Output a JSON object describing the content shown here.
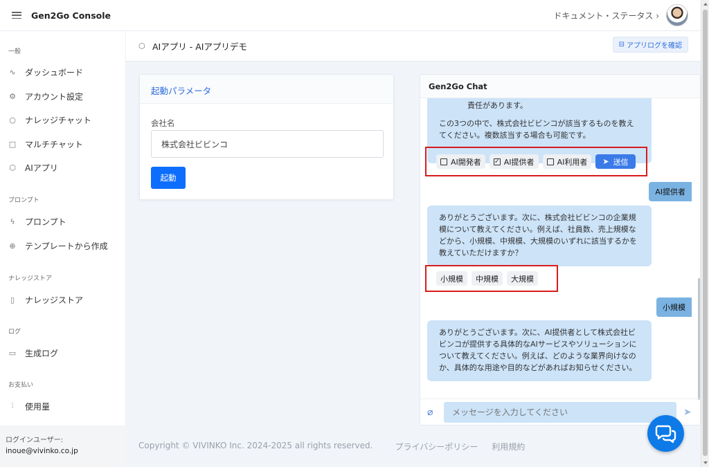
{
  "app": {
    "title": "Gen2Go Console"
  },
  "topbar": {
    "link": "ドキュメント・ステータス ›"
  },
  "sidebar": {
    "sections": [
      {
        "title": "一般",
        "items": [
          {
            "label": "ダッシュボード",
            "icon": "activity-icon"
          },
          {
            "label": "アカウント設定",
            "icon": "gear-icon"
          },
          {
            "label": "ナレッジチャット",
            "icon": "chat-bubble-icon"
          },
          {
            "label": "マルチチャット",
            "icon": "message-square-icon"
          },
          {
            "label": "AIアプリ",
            "icon": "box-icon"
          }
        ]
      },
      {
        "title": "プロンプト",
        "items": [
          {
            "label": "プロンプト",
            "icon": "lightning-icon"
          },
          {
            "label": "テンプレートから作成",
            "icon": "plus-circle-icon"
          }
        ]
      },
      {
        "title": "ナレッジストア",
        "items": [
          {
            "label": "ナレッジストア",
            "icon": "book-icon"
          }
        ]
      },
      {
        "title": "ログ",
        "items": [
          {
            "label": "生成ログ",
            "icon": "archive-icon"
          }
        ]
      },
      {
        "title": "お支払い",
        "items": [
          {
            "label": "使用量",
            "icon": "bar-chart-icon"
          }
        ]
      }
    ],
    "login_label": "ログインユーザー:",
    "login_email": "inoue@vivinko.co.jp"
  },
  "header": {
    "title": "AIアプリ - AIアプリデモ",
    "log_button": "アプリログを確認"
  },
  "params": {
    "title": "起動パラメータ",
    "company_label": "会社名",
    "company_value": "株式会社ビビンコ",
    "start_button": "起動"
  },
  "chat": {
    "title": "Gen2Go Chat",
    "msg1_line1": "責任があります。",
    "msg1_line2": "この3つの中で、株式会社ビビンコが該当するものを教え",
    "msg1_line3": "てください。複数該当する場合も可能です。",
    "options1": [
      {
        "label": "AI開発者",
        "checked": false
      },
      {
        "label": "AI提供者",
        "checked": true
      },
      {
        "label": "AI利用者",
        "checked": false
      }
    ],
    "send_label": "送信",
    "user1": "AI提供者",
    "msg2_lines": [
      "ありがとうございます。次に、株式会社ビビンコの企業規",
      "模について教えてください。例えば、社員数、売上規模な",
      "どから、小規模、中規模、大規模のいずれに該当するかを",
      "教えていただけますか？"
    ],
    "options2": [
      "小規模",
      "中規模",
      "大規模"
    ],
    "user2": "小規模",
    "msg3_lines": [
      "ありがとうございます。次に、AI提供者として株式会社ビ",
      "ビンコが提供する具体的なAIサービスやソリューションに",
      "ついて教えてください。例えば、どのような業界向けなの",
      "か、具体的な用途や目的などがあればお知らせください。"
    ],
    "input_placeholder": "メッセージを入力してください"
  },
  "footer": {
    "copyright": "Copyright © VIVINKO Inc. 2024-2025 all rights reserved.",
    "privacy": "プライバシーポリシー",
    "terms": "利用規約"
  }
}
